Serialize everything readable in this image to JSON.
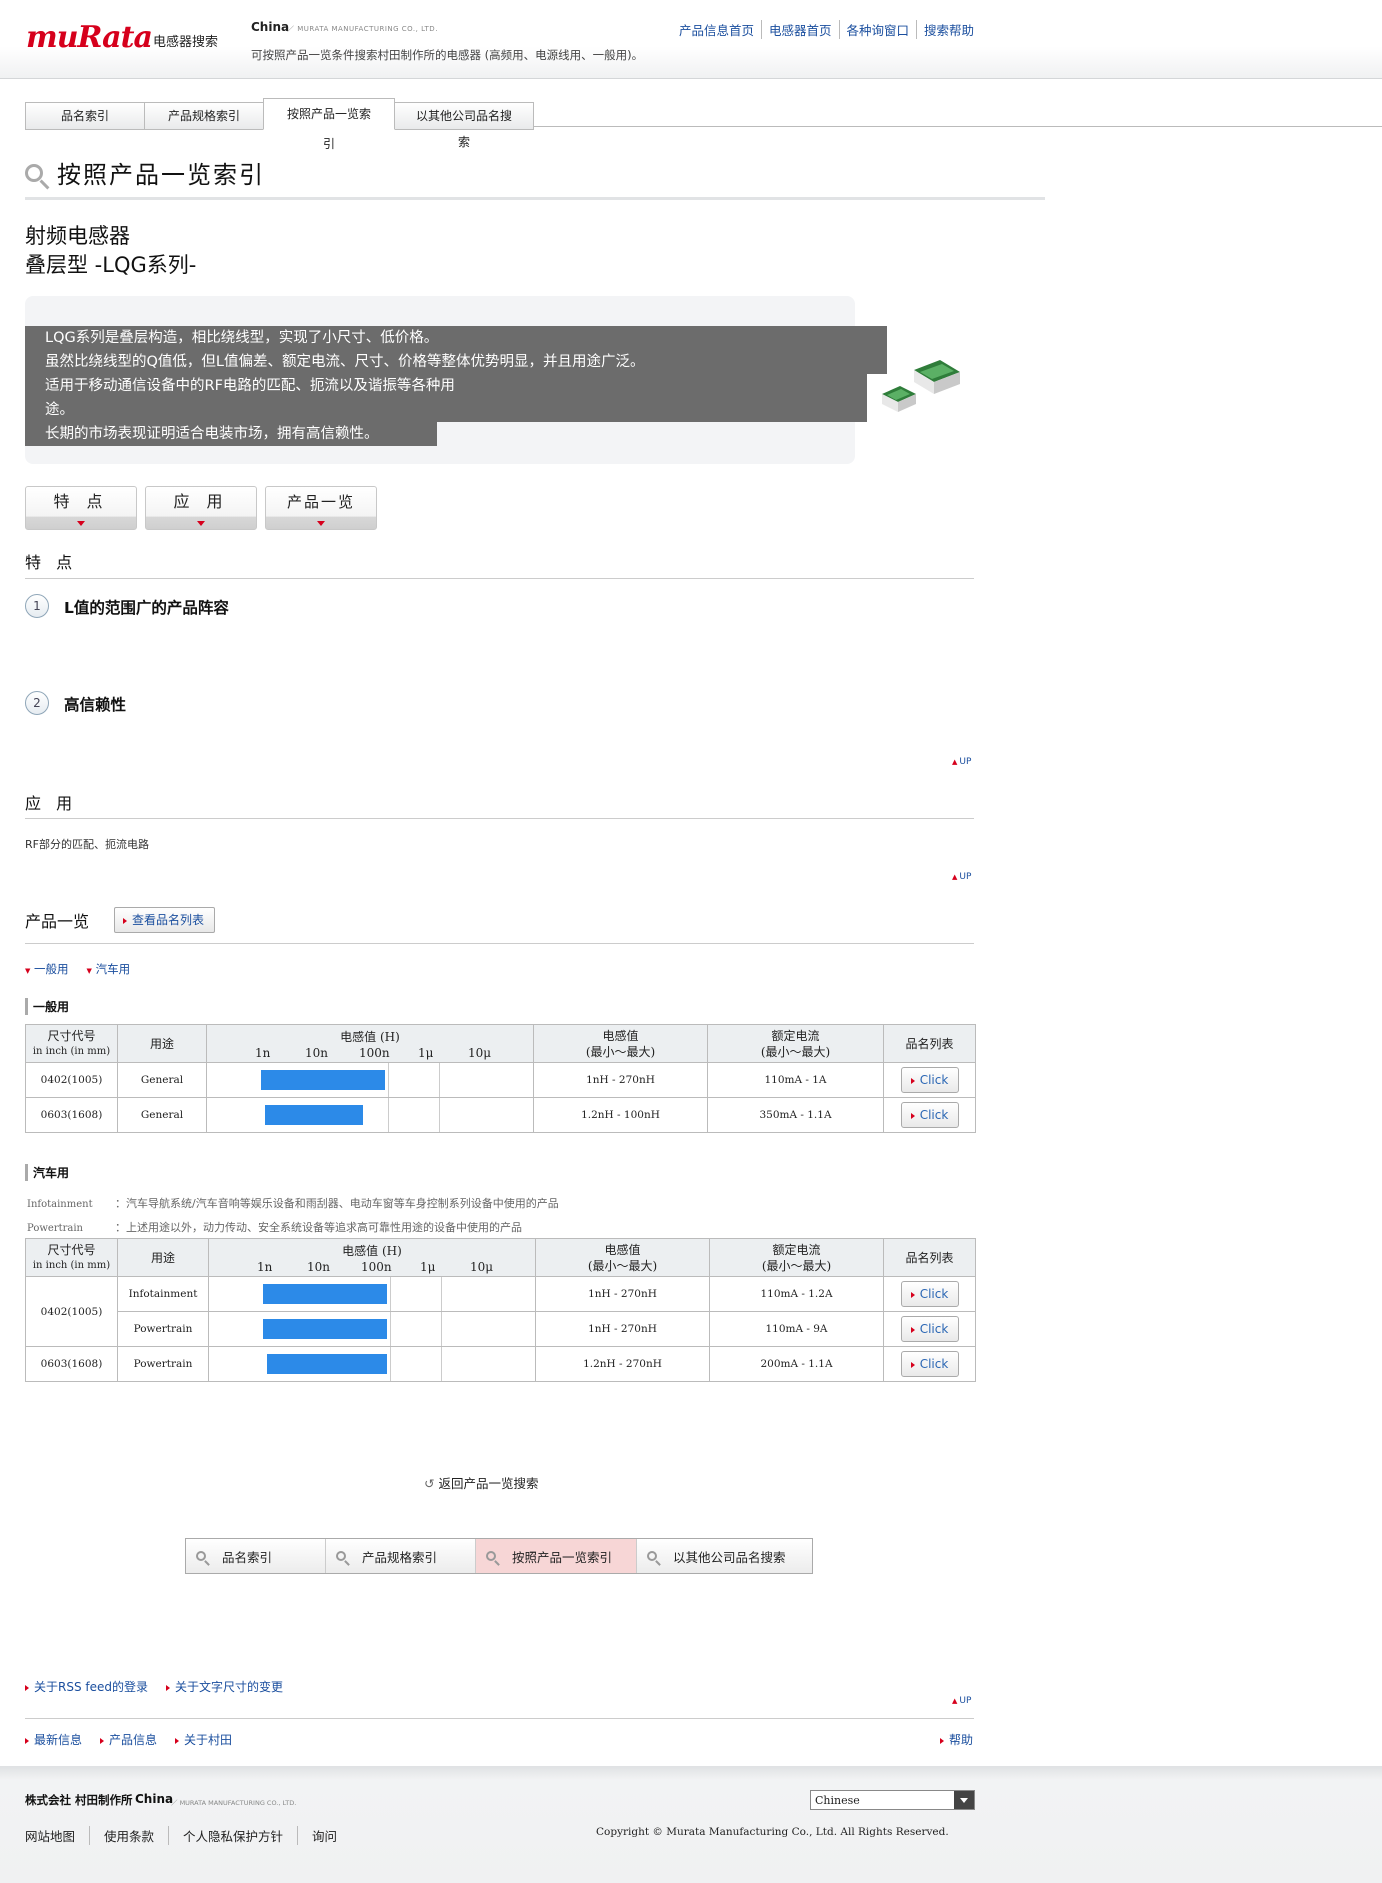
{
  "header": {
    "logo_text": "muRata",
    "site_name": "电感器搜索",
    "region": "China",
    "region_sub": "／ MURATA MANUFACTURING CO., LTD.",
    "description": "可按照产品一览条件搜索村田制作所的电感器 (高频用、电源线用、一般用)。",
    "nav": [
      "产品信息首页",
      "电感器首页",
      "各种询窗口",
      "搜索帮助"
    ]
  },
  "tabs": [
    "品名索引",
    "产品规格索引",
    "按照产品一览索引",
    "以其他公司品名搜索"
  ],
  "page_title": "按照产品一览索引",
  "category": {
    "line1": "射频电感器",
    "line2": "叠层型 -LQG系列-"
  },
  "description": [
    "LQG系列是叠层构造，相比绕线型，实现了小尺寸、低价格。",
    "虽然比绕线型的Q值低，但L值偏差、额定电流、尺寸、价格等整体优势明显，并且用途广泛。",
    "适用于移动通信设备中的RF电路的匹配、扼流以及谐振等各种用途。",
    "长期的市场表现证明适合电装市场，拥有高信赖性。"
  ],
  "section_buttons": [
    "特 点",
    "应 用",
    "产品一览"
  ],
  "features": {
    "heading": "特 点",
    "items": [
      {
        "num": "1",
        "title": "L值的范围广的产品阵容"
      },
      {
        "num": "2",
        "title": "高信赖性"
      }
    ]
  },
  "up_label": "UP",
  "applications": {
    "heading": "应 用",
    "text": "RF部分的匹配、扼流电路"
  },
  "product_list": {
    "heading": "产品一览",
    "view_button": "查看品名列表",
    "filters": [
      "一般用",
      "汽车用"
    ]
  },
  "general": {
    "heading": "一般用",
    "headers": {
      "size": "尺寸代号",
      "size_sub": "in inch (in mm)",
      "use": "用途",
      "inductance": "电感值 (H)",
      "ind_range": "电感值",
      "ind_range_sub": "(最小～最大)",
      "current": "额定电流",
      "current_sub": "(最小～最大)",
      "list": "品名列表"
    },
    "scale": [
      "1n",
      "10n",
      "100n",
      "1μ",
      "10μ"
    ],
    "rows": [
      {
        "size": "0402(1005)",
        "use": "General",
        "ind_min_nH": 1,
        "ind_max_nH": 270,
        "ind": "1nH - 270nH",
        "current": "110mA - 1A",
        "btn": "Click"
      },
      {
        "size": "0603(1608)",
        "use": "General",
        "ind_min_nH": 1.2,
        "ind_max_nH": 100,
        "ind": "1.2nH - 100nH",
        "current": "350mA - 1.1A",
        "btn": "Click"
      }
    ]
  },
  "automotive": {
    "heading": "汽车用",
    "notes": [
      {
        "term": "Infotainment",
        "text": "：汽车导航系统/汽车音响等娱乐设备和雨刮器、电动车窗等车身控制系列设备中使用的产品"
      },
      {
        "term": "Powertrain",
        "text": "：上述用途以外，动力传动、安全系统设备等追求高可靠性用途的设备中使用的产品"
      }
    ],
    "scale": [
      "1n",
      "10n",
      "100n",
      "1μ",
      "10μ"
    ],
    "rows": [
      {
        "size": "0402(1005)",
        "use": "Infotainment",
        "ind_min_nH": 1,
        "ind_max_nH": 270,
        "ind": "1nH - 270nH",
        "current": "110mA - 1.2A",
        "btn": "Click"
      },
      {
        "size": "",
        "use": "Powertrain",
        "ind_min_nH": 1,
        "ind_max_nH": 270,
        "ind": "1nH - 270nH",
        "current": "110mA - 9A",
        "btn": "Click"
      },
      {
        "size": "0603(1608)",
        "use": "Powertrain",
        "ind_min_nH": 1.2,
        "ind_max_nH": 270,
        "ind": "1.2nH - 270nH",
        "current": "200mA - 1.1A",
        "btn": "Click"
      }
    ]
  },
  "back_link": "返回产品一览搜索",
  "bottom_nav": [
    "品名索引",
    "产品规格索引",
    "按照产品一览索引",
    "以其他公司品名搜索"
  ],
  "utility_links": [
    "关于RSS feed的登录",
    "关于文字尺寸的变更"
  ],
  "footer_links_left": [
    "最新信息",
    "产品信息",
    "关于村田"
  ],
  "footer_help": "帮助",
  "footer": {
    "company": "株式会社 村田制作所",
    "region": "China",
    "region_sub": "／ MURATA MANUFACTURING CO., LTD.",
    "language": "Chinese",
    "links": [
      "网站地图",
      "使用条款",
      "个人隐私保护方针",
      "询问"
    ],
    "copyright": "Copyright © Murata Manufacturing Co., Ltd. All Rights Reserved."
  },
  "colors": {
    "brand_red": "#d6001c",
    "bar_blue": "#2c8ae8",
    "link_blue": "#1a4e9e"
  }
}
